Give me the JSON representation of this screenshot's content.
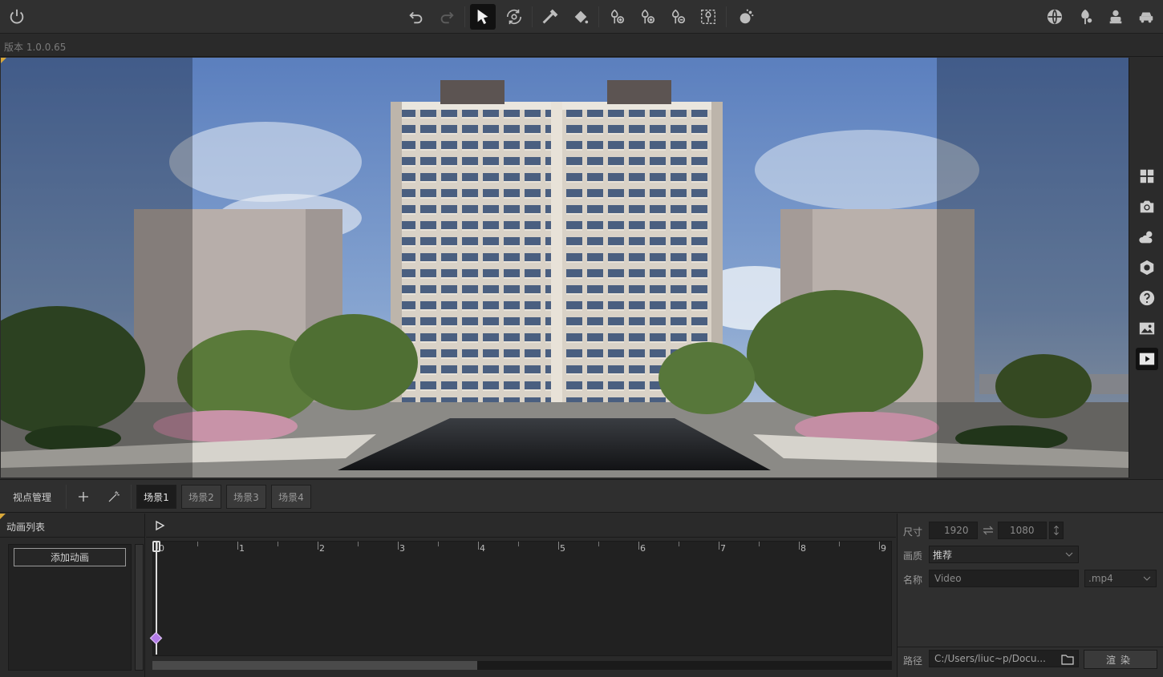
{
  "app": {
    "version_label": "版本 1.0.0.65"
  },
  "toolbar": {
    "left": [
      {
        "icon": "power-icon"
      }
    ],
    "center": [
      {
        "icon": "undo-icon"
      },
      {
        "icon": "redo-icon"
      },
      {
        "icon": "select-arrow-icon",
        "active": true
      },
      {
        "icon": "orbit-icon"
      },
      {
        "icon": "eyedropper-icon"
      },
      {
        "icon": "paint-bucket-icon"
      },
      {
        "icon": "add-tree-icon"
      },
      {
        "icon": "add-plant-icon"
      },
      {
        "icon": "remove-plant-icon"
      },
      {
        "icon": "select-plant-icon"
      },
      {
        "icon": "weather-effect-icon"
      }
    ],
    "right": [
      {
        "icon": "globe-icon"
      },
      {
        "icon": "tree-library-icon"
      },
      {
        "icon": "person-icon"
      },
      {
        "icon": "car-icon"
      }
    ]
  },
  "side_panel": [
    {
      "icon": "grid-icon"
    },
    {
      "icon": "camera-icon"
    },
    {
      "icon": "weather-icon"
    },
    {
      "icon": "settings-hex-icon"
    },
    {
      "icon": "help-icon"
    },
    {
      "icon": "image-icon"
    },
    {
      "icon": "video-play-icon",
      "active": true
    }
  ],
  "viewpoint": {
    "title": "视点管理",
    "scenes": [
      "场景1",
      "场景2",
      "场景3",
      "场景4"
    ],
    "active_scene_index": 0
  },
  "animation_list": {
    "title": "动画列表",
    "add_button": "添加动画"
  },
  "timeline": {
    "ticks": [
      "0",
      "1",
      "2",
      "3",
      "4",
      "5",
      "6",
      "7",
      "8",
      "9"
    ]
  },
  "render": {
    "size_label": "尺寸",
    "width": "1920",
    "height": "1080",
    "quality_label": "画质",
    "quality_value": "推荐",
    "name_label": "名称",
    "name_value": "Video",
    "format_value": ".mp4",
    "path_label": "路径",
    "path_value": "C:/Users/liuc~p/Docu...",
    "render_button": "渲染"
  },
  "colors": {
    "accent_purple": "#b37be8",
    "corner_marker": "#d9a83a",
    "sky": "#6f8fc0"
  }
}
